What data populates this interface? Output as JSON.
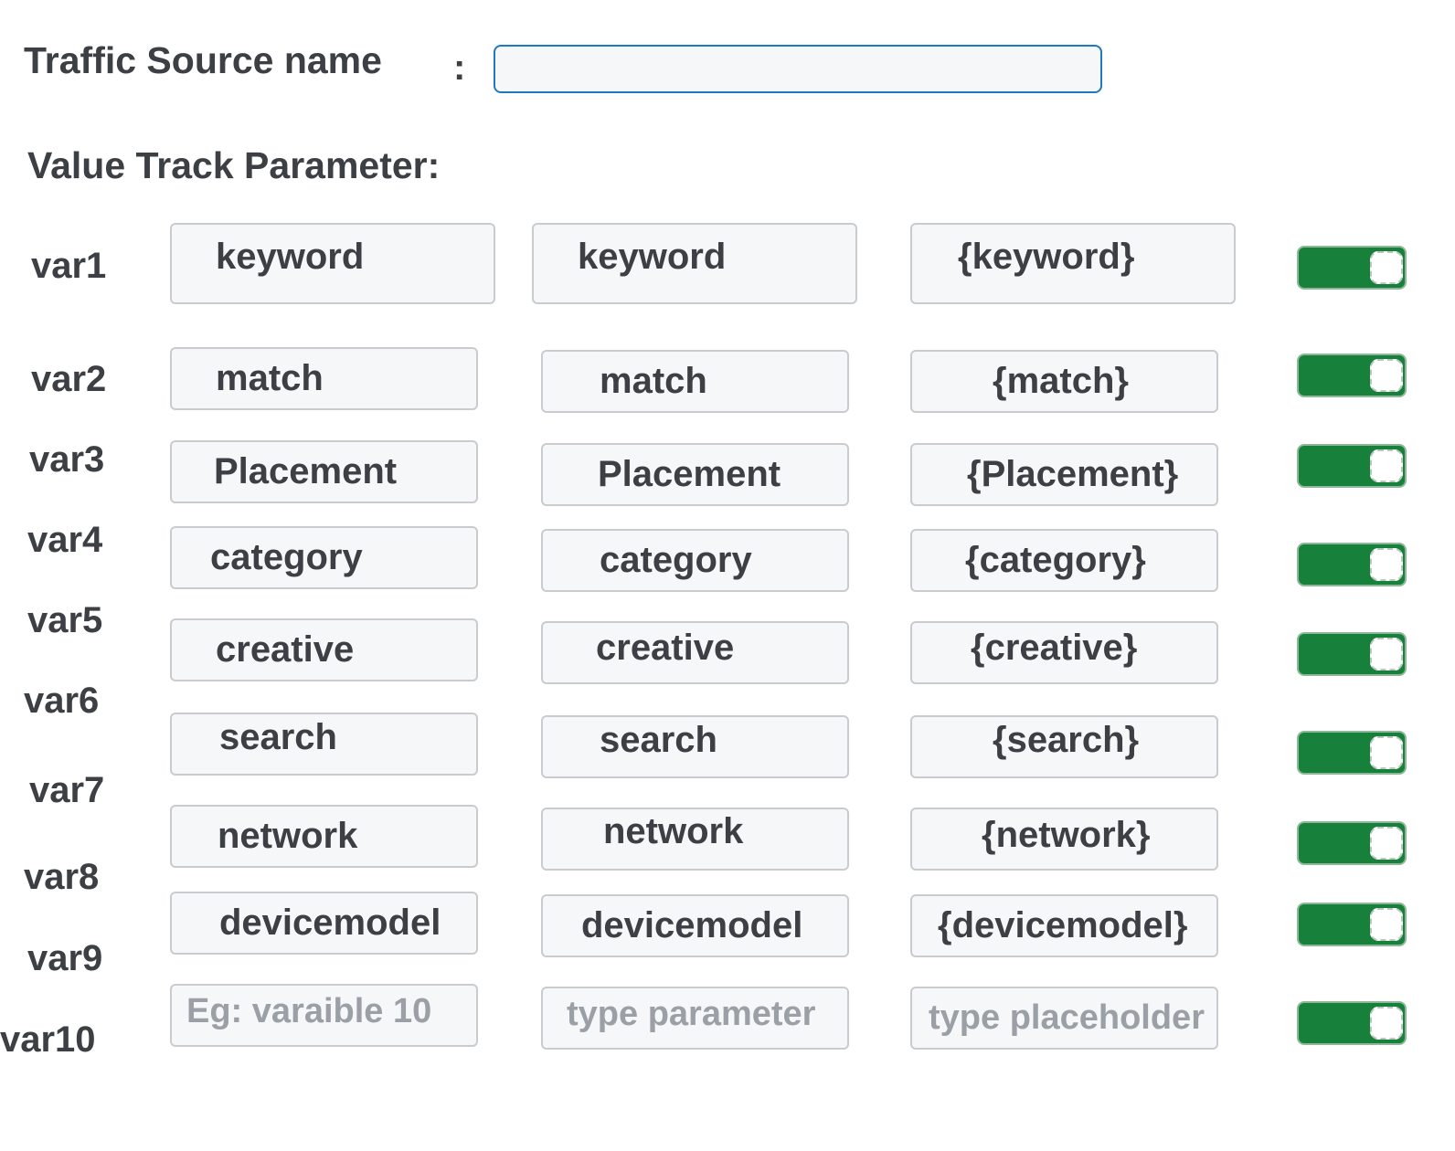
{
  "form": {
    "source_name_label": "Traffic Source name",
    "colon": ":",
    "source_name_value": "",
    "section_title": "Value Track Parameter:"
  },
  "colors": {
    "toggle_on": "#17803a",
    "input_focus_border": "#1f79be",
    "field_border": "#c9cbcf"
  },
  "rows": [
    {
      "label": "var1",
      "name": "keyword",
      "parameter": "keyword",
      "placeholder": "{keyword}",
      "enabled": true
    },
    {
      "label": "var2",
      "name": "match",
      "parameter": "match",
      "placeholder": "{match}",
      "enabled": true
    },
    {
      "label": "var3",
      "name": "Placement",
      "parameter": "Placement",
      "placeholder": "{Placement}",
      "enabled": true
    },
    {
      "label": "var4",
      "name": "category",
      "parameter": "category",
      "placeholder": "{category}",
      "enabled": true
    },
    {
      "label": "var5",
      "name": "creative",
      "parameter": "creative",
      "placeholder": "{creative}",
      "enabled": true
    },
    {
      "label": "var6",
      "name": "search",
      "parameter": "search",
      "placeholder": "{search}",
      "enabled": true
    },
    {
      "label": "var7",
      "name": "network",
      "parameter": "network",
      "placeholder": "{network}",
      "enabled": true
    },
    {
      "label": "var8",
      "name": "devicemodel",
      "parameter": "devicemodel",
      "placeholder": "{devicemodel}",
      "enabled": true
    },
    {
      "label": "var9",
      "name": "",
      "parameter": "",
      "placeholder": "",
      "enabled": true
    },
    {
      "label": "var10",
      "name": "",
      "parameter": "",
      "placeholder": "",
      "enabled": true
    }
  ],
  "empty_row_hints": {
    "name": "Eg: varaible 10",
    "parameter": "type parameter",
    "placeholder": "type placeholder"
  }
}
